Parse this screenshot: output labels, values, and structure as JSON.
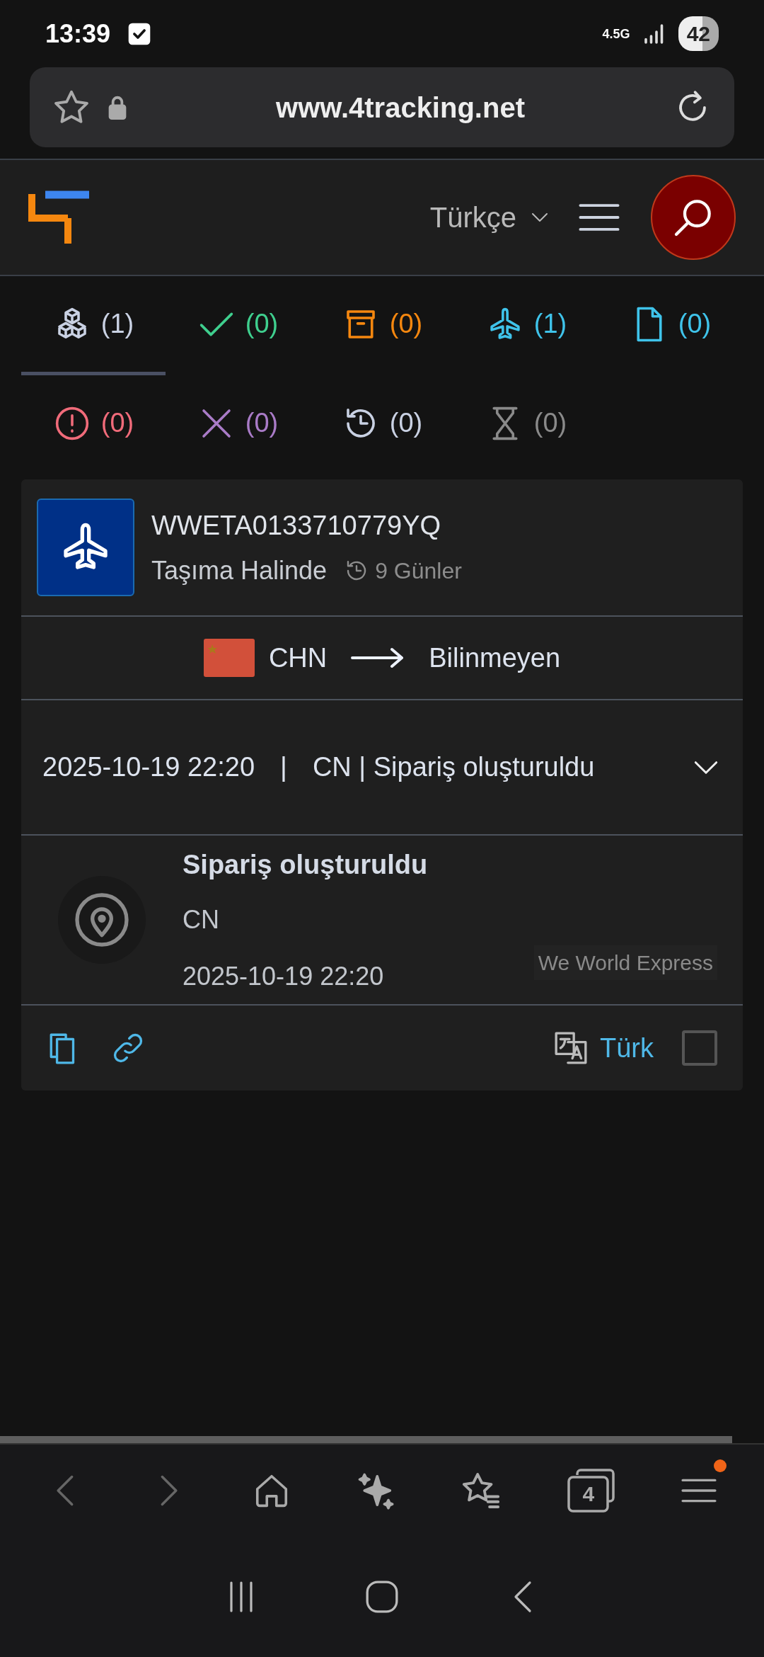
{
  "status_bar": {
    "time": "13:39",
    "network": "4.5G",
    "battery": "42"
  },
  "browser": {
    "url": "www.4tracking.net"
  },
  "site_header": {
    "language": "Türkçe"
  },
  "filter_tabs": [
    {
      "kind": "all",
      "count": "(1)",
      "selected": true,
      "color": "#c9d1e3"
    },
    {
      "kind": "delivered",
      "count": "(0)",
      "selected": false,
      "color": "#3fcf8e"
    },
    {
      "kind": "pickup",
      "count": "(0)",
      "selected": false,
      "color": "#f5870f"
    },
    {
      "kind": "transit",
      "count": "(1)",
      "selected": false,
      "color": "#3fc3ea"
    },
    {
      "kind": "info",
      "count": "(0)",
      "selected": false,
      "color": "#3fc3ea"
    },
    {
      "kind": "alert",
      "count": "(0)",
      "selected": false,
      "color": "#f06b7a"
    },
    {
      "kind": "failed",
      "count": "(0)",
      "selected": false,
      "color": "#a97bc7"
    },
    {
      "kind": "expired",
      "count": "(0)",
      "selected": false,
      "color": "#c9d1e3"
    },
    {
      "kind": "pending",
      "count": "(0)",
      "selected": false,
      "color": "#8a8a8a"
    }
  ],
  "shipment": {
    "tracking_number": "WWETA0133710779YQ",
    "status": "Taşıma Halinde",
    "days": "9 Günler",
    "origin": "CHN",
    "destination": "Bilinmeyen",
    "latest_event": {
      "date": "2025-10-19 22:20",
      "separator": "|",
      "summary": "CN | Sipariş oluşturuldu"
    },
    "events": [
      {
        "title": "Sipariş oluşturuldu",
        "location": "CN",
        "time": "2025-10-19 22:20",
        "carrier": "We World Express"
      }
    ],
    "translate": {
      "label": "Türk",
      "checked": false
    }
  },
  "bottom_bar": {
    "tab_count": "4",
    "menu_notification": true
  }
}
